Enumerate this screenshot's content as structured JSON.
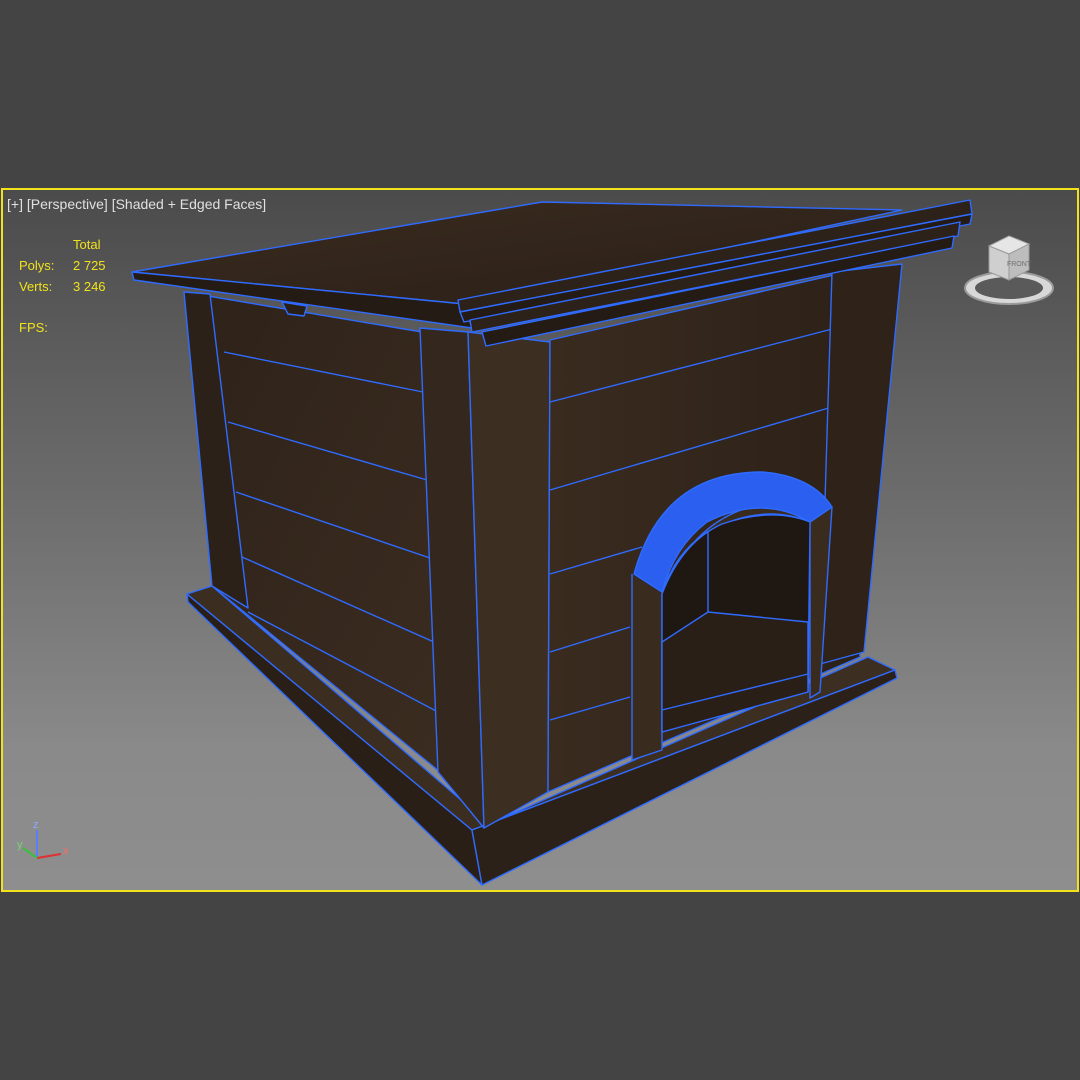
{
  "viewport": {
    "menu_label": "[+]",
    "view_label": "[Perspective]",
    "shading_label": "[Shaded + Edged Faces]"
  },
  "stats": {
    "header": "Total",
    "polys_label": "Polys:",
    "polys_value": "2 725",
    "verts_label": "Verts:",
    "verts_value": "3 246",
    "fps_label": "FPS:"
  },
  "viewcube": {
    "face_label": "FRONT",
    "icon": "viewcube-icon"
  },
  "axis": {
    "x": "x",
    "y": "y",
    "z": "z"
  },
  "colors": {
    "border_active": "#f2e21c",
    "stats_text": "#f2e21c",
    "edges": "#2f6bff",
    "wood": "#3b2c20",
    "background_outer": "#444444"
  }
}
